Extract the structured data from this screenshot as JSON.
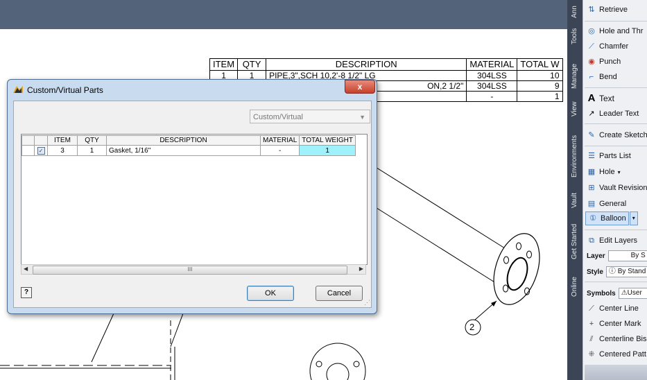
{
  "bom_table": {
    "headers": [
      "ITEM",
      "QTY",
      "DESCRIPTION",
      "MATERIAL",
      "TOTAL W"
    ],
    "rows": [
      [
        "1",
        "1",
        "PIPE,3\",SCH 10,2'-8 1/2\" LG",
        "304LSS",
        "10"
      ],
      [
        "",
        "",
        "ON,2 1/2\"",
        "304LSS",
        "9"
      ],
      [
        "",
        "",
        "",
        "-",
        "1"
      ]
    ]
  },
  "balloon_label": "2",
  "ribbon": {
    "tabs": [
      "Ann",
      "Tools",
      "Manage",
      "View",
      "Environments",
      "Vault",
      "Get Started",
      "Online"
    ],
    "items": {
      "retrieve": "Retrieve",
      "hole_thread": "Hole and Thr",
      "chamfer": "Chamfer",
      "punch": "Punch",
      "bend": "Bend",
      "text": "Text",
      "leader_text": "Leader Text",
      "create_sketch": "Create Sketch",
      "parts_list": "Parts List",
      "hole": "Hole",
      "vault_revision": "Vault Revision",
      "general": "General",
      "balloon": "Balloon",
      "edit_layers": "Edit Layers",
      "layer_label": "Layer",
      "layer_value": "By S",
      "style_label": "Style",
      "style_value": "By Stand",
      "symbols_label": "Symbols",
      "symbols_value": "User",
      "center_line": "Center Line",
      "center_mark": "Center Mark",
      "centerline_bisector": "Centerline Bis",
      "centered_pattern": "Centered Patt"
    }
  },
  "dialog": {
    "title": "Custom/Virtual Parts",
    "close": "x",
    "combo_value": "Custom/Virtual",
    "grid_headers": [
      "ITEM",
      "QTY",
      "DESCRIPTION",
      "MATERIAL",
      "TOTAL WEIGHT"
    ],
    "grid_rows": [
      [
        "3",
        "1",
        "Gasket, 1/16\"",
        "-",
        "1"
      ]
    ],
    "scroll_grip": "III",
    "help": "?",
    "ok": "OK",
    "cancel": "Cancel"
  },
  "colors": {
    "topbar": "#52637a",
    "highlight_cell": "#9ff2fb",
    "ribbon_tabs": "#3c4556"
  }
}
